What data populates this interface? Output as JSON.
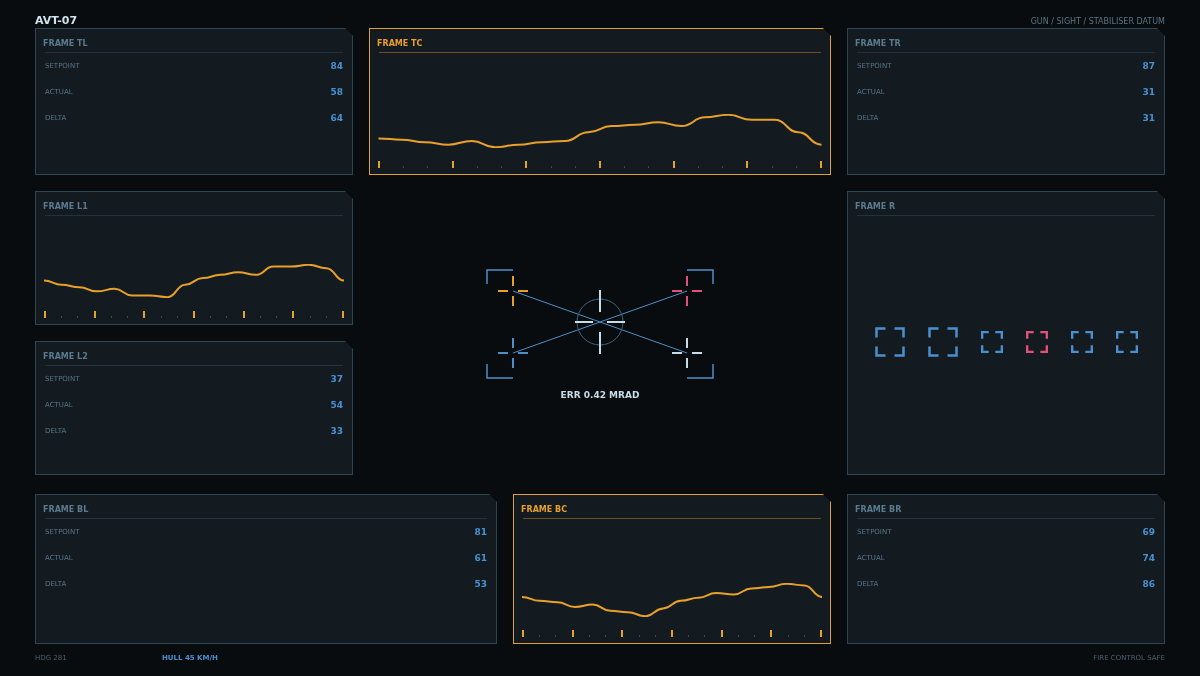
{
  "header": {
    "title": "AVT-07",
    "subtitle": "GUN / SIGHT / STABILISER DATUM"
  },
  "panels": [
    {
      "kind": "stats",
      "title": "FRAME TL",
      "highlighted": false,
      "rows": [
        {
          "label": "SETPOINT",
          "value": "84"
        },
        {
          "label": "ACTUAL",
          "value": "58"
        },
        {
          "label": "DELTA",
          "value": "64"
        }
      ]
    },
    {
      "kind": "wave",
      "title": "FRAME TC",
      "highlighted": true
    },
    {
      "kind": "stats",
      "title": "FRAME TR",
      "highlighted": false,
      "rows": [
        {
          "label": "SETPOINT",
          "value": "87"
        },
        {
          "label": "ACTUAL",
          "value": "31"
        },
        {
          "label": "DELTA",
          "value": "31"
        }
      ]
    },
    {
      "kind": "wave",
      "title": "FRAME L1",
      "highlighted": false
    },
    {
      "kind": "stats",
      "title": "FRAME L2",
      "highlighted": false,
      "rows": [
        {
          "label": "SETPOINT",
          "value": "37"
        },
        {
          "label": "ACTUAL",
          "value": "54"
        },
        {
          "label": "DELTA",
          "value": "33"
        }
      ]
    },
    {
      "kind": "targets",
      "title": "FRAME R",
      "highlighted": false,
      "targets": [
        {
          "color": "#4a90d0"
        },
        {
          "color": "#4a90d0"
        },
        {
          "color": "#4a90d0"
        },
        {
          "color": "#e0507a"
        },
        {
          "color": "#4a90d0"
        },
        {
          "color": "#4a90d0"
        }
      ]
    },
    {
      "kind": "stats",
      "title": "FRAME BL",
      "highlighted": false,
      "rows": [
        {
          "label": "SETPOINT",
          "value": "81"
        },
        {
          "label": "ACTUAL",
          "value": "61"
        },
        {
          "label": "DELTA",
          "value": "53"
        }
      ]
    },
    {
      "kind": "wave",
      "title": "FRAME BC",
      "highlighted": true
    },
    {
      "kind": "stats",
      "title": "FRAME BR",
      "highlighted": false,
      "rows": [
        {
          "label": "SETPOINT",
          "value": "69"
        },
        {
          "label": "ACTUAL",
          "value": "74"
        },
        {
          "label": "DELTA",
          "value": "86"
        }
      ]
    }
  ],
  "reticle": {
    "readout": "ERR 0.42 MRAD"
  },
  "footer": {
    "heading": "HDG 281",
    "speed": "HULL 45 KM/H",
    "status": "FIRE CONTROL SAFE"
  }
}
